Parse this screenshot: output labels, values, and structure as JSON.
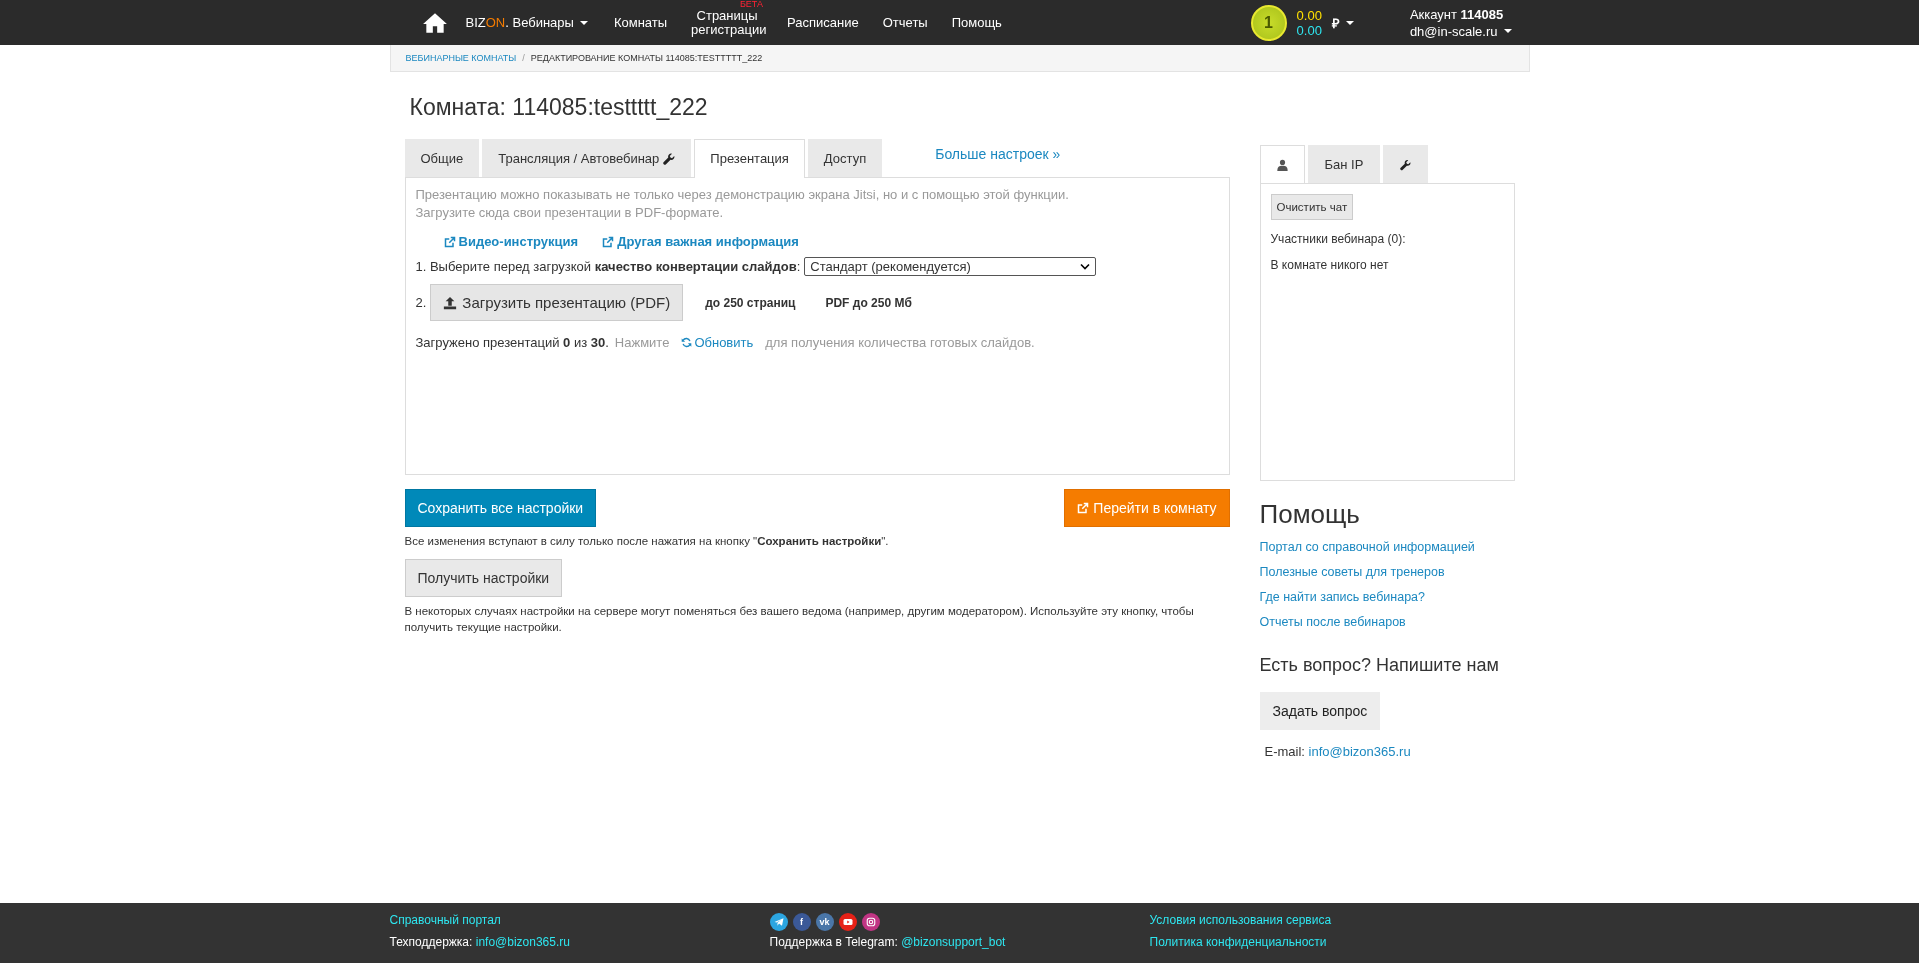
{
  "navbar": {
    "brand": {
      "first": "BIZ",
      "accent": "ON",
      "rest": ". Вебинары"
    },
    "items": [
      {
        "label": "Комнаты"
      },
      {
        "label": "Страницы регистрации",
        "badge": "БЕТА"
      },
      {
        "label": "Расписание"
      },
      {
        "label": "Отчеты"
      },
      {
        "label": "Помощь"
      }
    ],
    "coin": "1",
    "balance_main": "0.00",
    "balance_bonus": "0.00",
    "currency": "₽",
    "account": "Аккаунт **114085**",
    "email": "dh@in-scale.ru"
  },
  "breadcrumb_separator": "/",
  "breadcrumb": [
    {
      "label": "ВЕБИНАРНЫЕ КОМНАТЫ",
      "link": true
    },
    {
      "label": "РЕДАКТИРОВАНИЕ КОМНАТЫ 114085:TESTTTTT_222",
      "link": false
    }
  ],
  "title": "Комната: 114085:testtttt_222",
  "tabs": [
    {
      "label": "Общие",
      "selected": false,
      "kind": "text"
    },
    {
      "label": "Трансляция / Автовебинар",
      "selected": false,
      "kind": "tool"
    },
    {
      "label": "Презентация",
      "selected": true,
      "kind": "text"
    },
    {
      "label": "Доступ",
      "selected": false,
      "kind": "text"
    }
  ],
  "more_settings": "Больше настроек »",
  "panel": {
    "intro": [
      "Презентацию можно показывать не только через демонстрацию экрана Jitsi, но и с помощью этой функции.",
      "Загрузите сюда свои презентации в PDF-формате."
    ],
    "links": [
      "Видео-инструкция",
      "Другая важная информация"
    ],
    "step1": "1. Выберите перед загрузкой **качество конвертации слайдов**:",
    "quality": "Стандарт (рекомендуется)",
    "step2": "2.",
    "upload": "Загрузить презентацию (PDF)",
    "limits": [
      "до 250 страниц",
      "PDF до 250 Мб"
    ],
    "status": "Загружено презентаций **0** из **30**.",
    "press": "Нажмите",
    "refresh": "Обновить",
    "status_tail": "для получения количества готовых слайдов."
  },
  "save": "Сохранить все настройки",
  "go": "Перейти в комнату",
  "save_note": "Все изменения вступают в силу только после нажатия на кнопку \"**Сохранить настройки**\".",
  "get": "Получить настройки",
  "get_note": "В некоторых случаях настройки на сервере могут поменяться без вашего ведома (например, другим модератором). Используйте эту кнопку, чтобы получить текущие настройки.",
  "side": {
    "tabs": [
      {
        "kind": "person",
        "selected": true
      },
      {
        "kind": "text",
        "label": "Бан IP",
        "selected": false
      },
      {
        "kind": "tool",
        "selected": false
      }
    ],
    "clear": "Очистить чат",
    "participants": "Участники вебинара (0):",
    "empty": "В комнате никого нет"
  },
  "help": {
    "title": "Помощь",
    "links": [
      "Портал со справочной информацией",
      "Полезные советы для тренеров",
      "Где найти запись вебинара?",
      "Отчеты после вебинаров"
    ],
    "question": "Есть вопрос? Напишите нам",
    "ask": "Задать вопрос",
    "email_label": "E-mail:",
    "email": "info@bizon365.ru"
  },
  "footer": {
    "portal": "Справочный портал",
    "support_label": "Техподдержка:",
    "support_email": "info@bizon365.ru",
    "social": [
      {
        "kind": "plane",
        "color": "#2ca5e0"
      },
      {
        "kind": "letter",
        "glyph": "f",
        "color": "#3b5998"
      },
      {
        "kind": "letter",
        "glyph": "vk",
        "color": "#4a76a8"
      },
      {
        "kind": "play",
        "color": "#e62117"
      },
      {
        "kind": "camera",
        "color": "#c13584"
      }
    ],
    "telegram_label": "Поддержка в Telegram:",
    "telegram": "@bizonsupport_bot",
    "terms": "Условия использования сервиса",
    "privacy": "Политика конфиденциальности"
  }
}
